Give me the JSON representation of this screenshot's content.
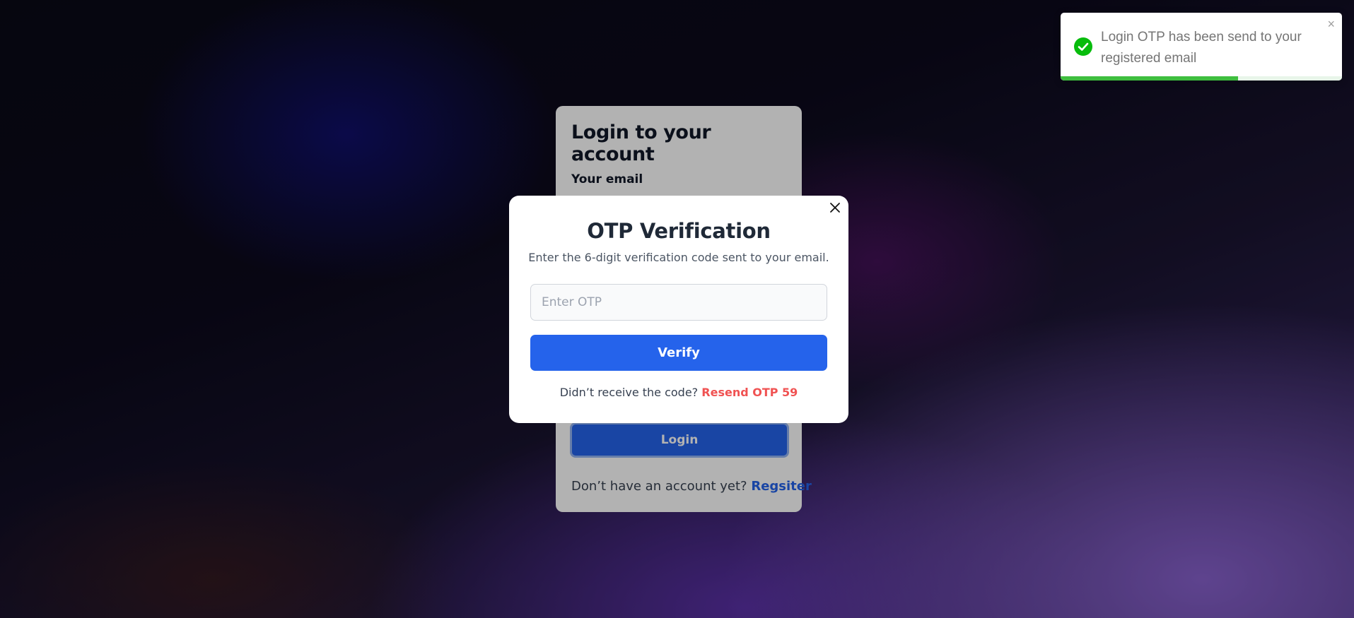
{
  "login": {
    "title": "Login to your account",
    "email_label": "Your email",
    "login_button": "Login",
    "register_prompt": "Don’t have an account yet?",
    "register_link": "Regsiter"
  },
  "modal": {
    "title": "OTP Verification",
    "subtitle": "Enter the 6-digit verification code sent to your email.",
    "input_placeholder": "Enter OTP",
    "input_value": "",
    "verify_button": "Verify",
    "resend_prompt": "Didn’t receive the code?",
    "resend_link": "Resend OTP 59",
    "close_icon": "close-icon"
  },
  "toast": {
    "message": "Login OTP has been send to your registered email",
    "icon": "check-circle-icon",
    "close_label": "×",
    "progress": 0.63,
    "status_color": "#07bc0c"
  },
  "colors": {
    "primary": "#2563eb",
    "resend": "#f05252"
  }
}
